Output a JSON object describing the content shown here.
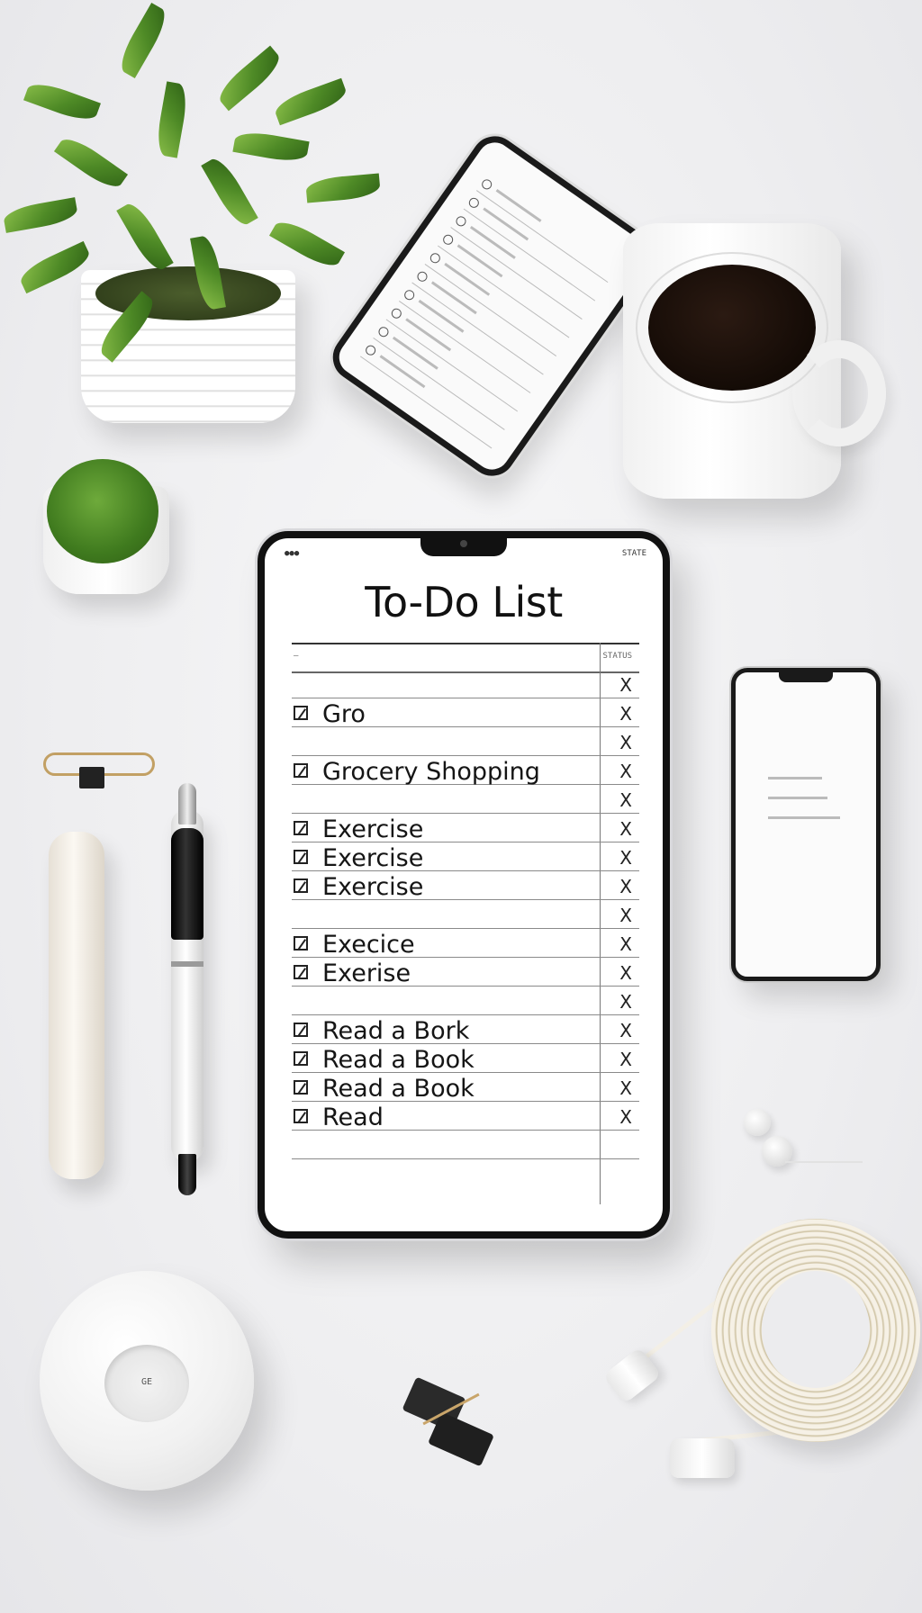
{
  "todo_app": {
    "title": "To-Do List",
    "header_left": "●●●",
    "header_right": "STATE",
    "column_left": "—",
    "column_right": "STATUS",
    "items": [
      {
        "label": "",
        "mark": "X"
      },
      {
        "label": "Gro",
        "mark": "X"
      },
      {
        "label": "",
        "mark": "X"
      },
      {
        "label": "Grocery Shopping",
        "mark": "X"
      },
      {
        "label": "",
        "mark": "X"
      },
      {
        "label": "Exercise",
        "mark": "X"
      },
      {
        "label": "Exercise",
        "mark": "X"
      },
      {
        "label": "Exercise",
        "mark": "X"
      },
      {
        "label": "",
        "mark": "X"
      },
      {
        "label": "Execice",
        "mark": "X"
      },
      {
        "label": "Exerise",
        "mark": "X"
      },
      {
        "label": "",
        "mark": "X"
      },
      {
        "label": "Read a Bork",
        "mark": "X"
      },
      {
        "label": "Read a Book",
        "mark": "X"
      },
      {
        "label": "Read a Book",
        "mark": "X"
      },
      {
        "label": "Read",
        "mark": "X"
      },
      {
        "label": "",
        "mark": ""
      }
    ]
  },
  "puck": {
    "label": "GE"
  },
  "colors": {
    "background": "#eeeef0",
    "ink": "#111111",
    "leaf_green": "#4e8a26",
    "coffee": "#140b06",
    "clip_gold": "#c2a064"
  }
}
